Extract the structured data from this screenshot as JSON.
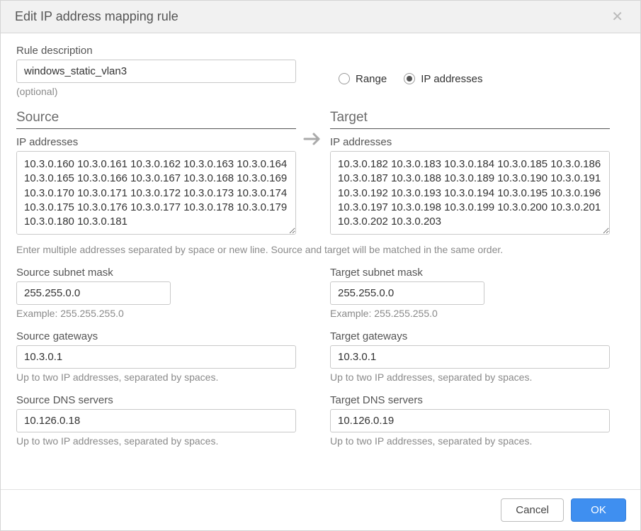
{
  "dialog": {
    "title": "Edit IP address mapping rule"
  },
  "description": {
    "label": "Rule description",
    "value": "windows_static_vlan3",
    "hint": "(optional)"
  },
  "type_radio": {
    "range_label": "Range",
    "ip_label": "IP addresses",
    "selected": "ip"
  },
  "source": {
    "heading": "Source",
    "ips_label": "IP addresses",
    "ips_value": "10.3.0.160 10.3.0.161 10.3.0.162 10.3.0.163 10.3.0.164 10.3.0.165 10.3.0.166 10.3.0.167 10.3.0.168 10.3.0.169 10.3.0.170 10.3.0.171 10.3.0.172 10.3.0.173 10.3.0.174 10.3.0.175 10.3.0.176 10.3.0.177 10.3.0.178 10.3.0.179 10.3.0.180 10.3.0.181",
    "subnet_label": "Source subnet mask",
    "subnet_value": "255.255.0.0",
    "subnet_hint": "Example: 255.255.255.0",
    "gateway_label": "Source gateways",
    "gateway_value": "10.3.0.1",
    "gateway_hint": "Up to two IP addresses, separated by spaces.",
    "dns_label": "Source DNS servers",
    "dns_value": "10.126.0.18",
    "dns_hint": "Up to two IP addresses, separated by spaces."
  },
  "target": {
    "heading": "Target",
    "ips_label": "IP addresses",
    "ips_value": "10.3.0.182 10.3.0.183 10.3.0.184 10.3.0.185 10.3.0.186 10.3.0.187 10.3.0.188 10.3.0.189 10.3.0.190 10.3.0.191 10.3.0.192 10.3.0.193 10.3.0.194 10.3.0.195 10.3.0.196 10.3.0.197 10.3.0.198 10.3.0.199 10.3.0.200 10.3.0.201 10.3.0.202 10.3.0.203",
    "subnet_label": "Target subnet mask",
    "subnet_value": "255.255.0.0",
    "subnet_hint": "Example: 255.255.255.0",
    "gateway_label": "Target gateways",
    "gateway_value": "10.3.0.1",
    "gateway_hint": "Up to two IP addresses, separated by spaces.",
    "dns_label": "Target DNS servers",
    "dns_value": "10.126.0.19",
    "dns_hint": "Up to two IP addresses, separated by spaces."
  },
  "ip_match_hint": "Enter multiple addresses separated by space or new line. Source and target will be matched in the same order.",
  "buttons": {
    "cancel": "Cancel",
    "ok": "OK"
  }
}
